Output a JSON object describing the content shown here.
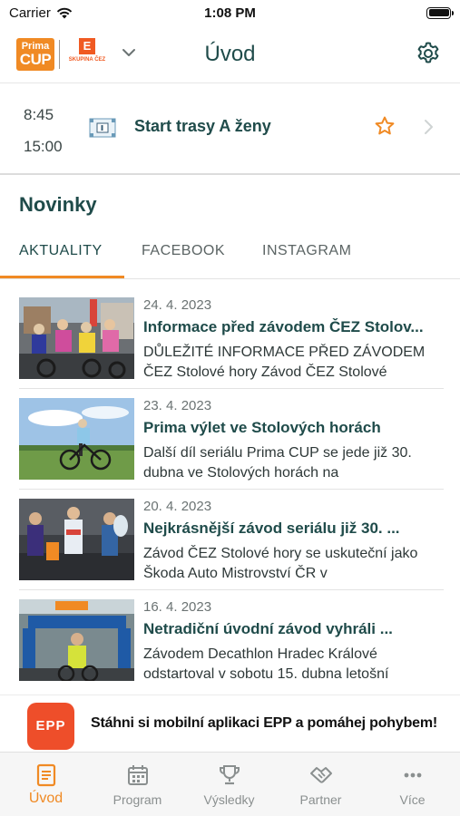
{
  "status_bar": {
    "carrier": "Carrier",
    "time": "1:08 PM"
  },
  "header": {
    "logo_prima_top": "Prima",
    "logo_prima_bottom": "CUP",
    "logo_cez_mark": "E",
    "logo_cez_text": "SKUPINA ČEZ",
    "title": "Úvod"
  },
  "featured": {
    "time_start": "8:45",
    "time_end": "15:00",
    "title": "Start trasy A ženy"
  },
  "news": {
    "section_title": "Novinky",
    "tabs": [
      {
        "label": "AKTUALITY",
        "active": true
      },
      {
        "label": "FACEBOOK",
        "active": false
      },
      {
        "label": "INSTAGRAM",
        "active": false
      }
    ],
    "items": [
      {
        "date": "24. 4. 2023",
        "headline": "Informace před závodem ČEZ Stolov...",
        "excerpt": "DŮLEŽITÉ INFORMACE PŘED ZÁVODEM ČEZ Stolové hory   Závod ČEZ Stolové"
      },
      {
        "date": "23. 4. 2023",
        "headline": "Prima výlet ve Stolových horách",
        "excerpt": "Další díl seriálu Prima CUP se jede již 30. dubna ve Stolových horách na"
      },
      {
        "date": "20. 4. 2023",
        "headline": "Nejkrásnější závod seriálu již 30. ...",
        "excerpt": "Závod ČEZ Stolové hory se uskuteční jako Škoda Auto Mistrovství ČR v"
      },
      {
        "date": "16. 4. 2023",
        "headline": "Netradiční úvodní závod vyhráli ...",
        "excerpt": "Závodem Decathlon Hradec Králové odstartoval v sobotu 15. dubna letošní"
      }
    ]
  },
  "banner": {
    "logo_text": "EPP",
    "text": "Stáhni si mobilní aplikaci EPP a pomáhej pohybem!"
  },
  "tabbar": {
    "items": [
      {
        "label": "Úvod",
        "icon": "document-icon",
        "active": true
      },
      {
        "label": "Program",
        "icon": "calendar-icon",
        "active": false
      },
      {
        "label": "Výsledky",
        "icon": "trophy-icon",
        "active": false
      },
      {
        "label": "Partner",
        "icon": "handshake-icon",
        "active": false
      },
      {
        "label": "Více",
        "icon": "more-dots-icon",
        "active": false
      }
    ]
  },
  "colors": {
    "accent": "#f08a24",
    "title_green": "#1f4b4a",
    "epp_red": "#ee4e2a"
  }
}
